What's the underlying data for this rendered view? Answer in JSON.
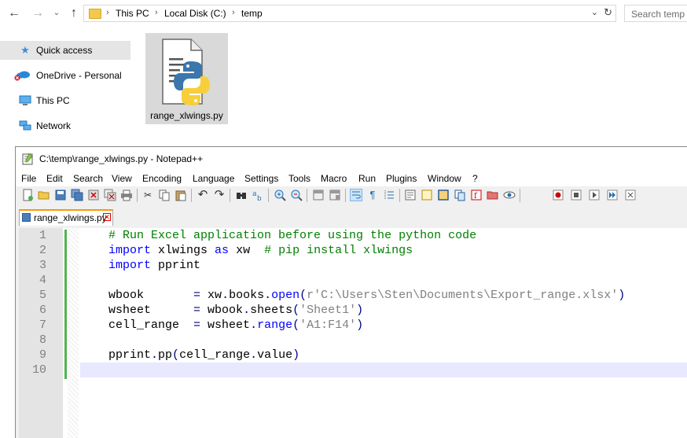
{
  "explorer": {
    "address": {
      "crumbs": [
        "This PC",
        "Local Disk (C:)",
        "temp"
      ]
    },
    "search_placeholder": "Search temp",
    "sidebar": [
      {
        "label": "Quick access",
        "icon": "star-icon",
        "selected": true
      },
      {
        "label": "OneDrive - Personal",
        "icon": "onedrive-icon"
      },
      {
        "label": "This PC",
        "icon": "computer-icon"
      },
      {
        "label": "Network",
        "icon": "network-icon"
      }
    ],
    "file": {
      "name": "range_xlwings.py",
      "icon": "python-file-icon"
    }
  },
  "notepad": {
    "title": "C:\\temp\\range_xlwings.py - Notepad++",
    "menu": [
      "File",
      "Edit",
      "Search",
      "View",
      "Encoding",
      "Language",
      "Settings",
      "Tools",
      "Macro",
      "Run",
      "Plugins",
      "Window",
      "?"
    ],
    "tab_label": "range_xlwings.py",
    "lines": [
      {
        "n": "1",
        "parts": [
          {
            "t": "    # Run Excel application before using the python code",
            "c": "cm"
          }
        ]
      },
      {
        "n": "2",
        "parts": [
          {
            "t": "    ",
            "c": ""
          },
          {
            "t": "import",
            "c": "kw"
          },
          {
            "t": " xlwings ",
            "c": ""
          },
          {
            "t": "as",
            "c": "kw"
          },
          {
            "t": " xw  ",
            "c": ""
          },
          {
            "t": "# pip install xlwings",
            "c": "cm"
          }
        ]
      },
      {
        "n": "3",
        "parts": [
          {
            "t": "    ",
            "c": ""
          },
          {
            "t": "import",
            "c": "kw"
          },
          {
            "t": " pprint",
            "c": ""
          }
        ]
      },
      {
        "n": "4",
        "parts": []
      },
      {
        "n": "5",
        "parts": [
          {
            "t": "    wbook       ",
            "c": ""
          },
          {
            "t": "=",
            "c": "op"
          },
          {
            "t": " xw",
            "c": ""
          },
          {
            "t": ".",
            "c": "op"
          },
          {
            "t": "books",
            "c": ""
          },
          {
            "t": ".",
            "c": "op"
          },
          {
            "t": "open",
            "c": "kw"
          },
          {
            "t": "(",
            "c": "op"
          },
          {
            "t": "r'C:\\Users\\Sten\\Documents\\Export_range.xlsx'",
            "c": "st"
          },
          {
            "t": ")",
            "c": "op"
          }
        ]
      },
      {
        "n": "6",
        "parts": [
          {
            "t": "    wsheet      ",
            "c": ""
          },
          {
            "t": "=",
            "c": "op"
          },
          {
            "t": " wbook",
            "c": ""
          },
          {
            "t": ".",
            "c": "op"
          },
          {
            "t": "sheets",
            "c": ""
          },
          {
            "t": "(",
            "c": "op"
          },
          {
            "t": "'Sheet1'",
            "c": "st"
          },
          {
            "t": ")",
            "c": "op"
          }
        ]
      },
      {
        "n": "7",
        "parts": [
          {
            "t": "    cell_range  ",
            "c": ""
          },
          {
            "t": "=",
            "c": "op"
          },
          {
            "t": " wsheet",
            "c": ""
          },
          {
            "t": ".",
            "c": "op"
          },
          {
            "t": "range",
            "c": "kw"
          },
          {
            "t": "(",
            "c": "op"
          },
          {
            "t": "'A1:F14'",
            "c": "st"
          },
          {
            "t": ")",
            "c": "op"
          }
        ]
      },
      {
        "n": "8",
        "parts": []
      },
      {
        "n": "9",
        "parts": [
          {
            "t": "    pprint",
            "c": ""
          },
          {
            "t": ".",
            "c": "op"
          },
          {
            "t": "pp",
            "c": ""
          },
          {
            "t": "(",
            "c": "op"
          },
          {
            "t": "cell_range",
            "c": ""
          },
          {
            "t": ".",
            "c": "op"
          },
          {
            "t": "value",
            "c": ""
          },
          {
            "t": ")",
            "c": "op"
          }
        ]
      },
      {
        "n": "10",
        "parts": [],
        "current": true
      }
    ]
  },
  "colors": {
    "keyword": "#0000ff",
    "comment": "#008000",
    "string": "#808080",
    "current_line": "#e8e8ff",
    "change_bar": "#4fb44f"
  }
}
